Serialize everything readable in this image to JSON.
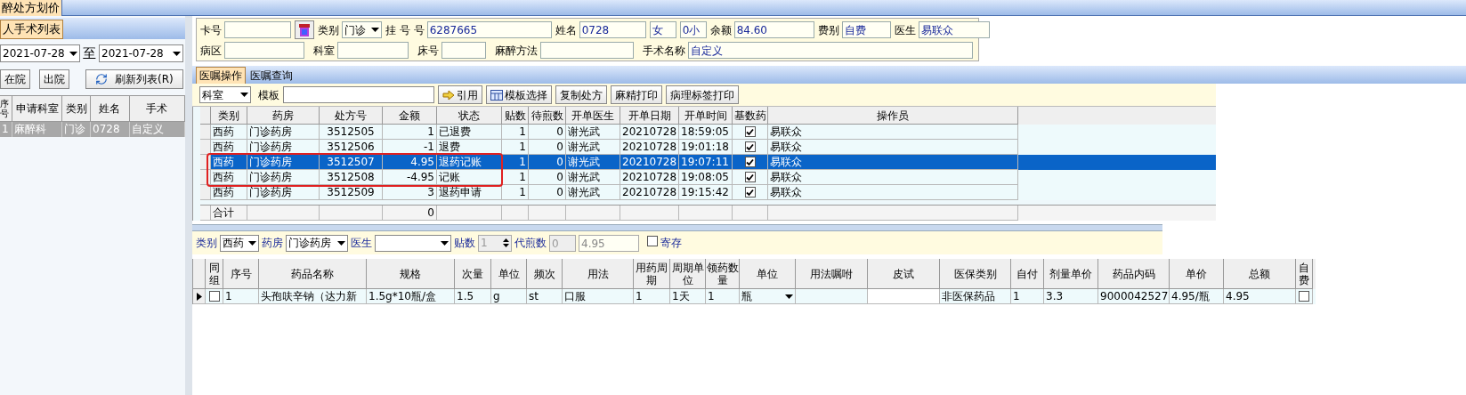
{
  "app_tab": "醉处方划价",
  "left": {
    "tab": "人手术列表",
    "date_from": "2021-07-28",
    "to_label": "至",
    "date_to": "2021-07-28",
    "buttons": [
      {
        "label": "在院",
        "kind": "plain"
      },
      {
        "label": "出院",
        "kind": "plain"
      },
      {
        "label": "刷新列表(R)",
        "kind": "refresh"
      }
    ],
    "columns": [
      "序号",
      "申请科室",
      "类别",
      "姓名",
      "手术"
    ],
    "rows": [
      {
        "cells": [
          "1",
          "麻醉科",
          "门诊",
          "0728",
          "自定义"
        ],
        "selected": true
      }
    ]
  },
  "form": {
    "line_1": [
      {
        "label": "卡号",
        "kind": "text"
      },
      {
        "kind": "reader"
      },
      {
        "label": "类别",
        "kind": "select",
        "value": "门诊"
      },
      {
        "label": "挂 号 号",
        "kind": "text",
        "value": "6287665"
      },
      {
        "label": "姓名",
        "kind": "text",
        "value": "0728"
      },
      {
        "kind": "text",
        "value": "女"
      },
      {
        "kind": "text",
        "value": "0小"
      },
      {
        "label": "余额",
        "kind": "text",
        "value": "84.60"
      },
      {
        "label": "费别",
        "kind": "text",
        "value": "自费"
      },
      {
        "label": "医生",
        "kind": "text",
        "value": "易联众"
      }
    ],
    "line_2": [
      {
        "label": "病区",
        "kind": "text"
      },
      {
        "label": "科室",
        "kind": "text"
      },
      {
        "label": "床号",
        "kind": "text"
      },
      {
        "label": "麻醉方法",
        "kind": "text"
      },
      {
        "label": "手术名称",
        "kind": "text",
        "value": "自定义"
      }
    ]
  },
  "tabs": [
    {
      "label": "医嘱操作",
      "selected": true
    },
    {
      "label": "医嘱查询",
      "selected": false
    }
  ],
  "toolbar": {
    "dept": "科室",
    "template_label": "模板",
    "buttons": [
      {
        "label": "引用",
        "kind": "quote"
      },
      {
        "label": "模板选择",
        "kind": "template"
      },
      {
        "label": "复制处方",
        "kind": "plain"
      },
      {
        "label": "麻精打印",
        "kind": "plain"
      },
      {
        "label": "病理标签打印",
        "kind": "plain"
      }
    ]
  },
  "orders": {
    "columns": [
      "类别",
      "药房",
      "处方号",
      "金额",
      "状态",
      "贴数",
      "待煎数",
      "开单医生",
      "开单日期",
      "开单时间",
      "基数药",
      "操作员"
    ],
    "rows": [
      {
        "cells": [
          "西药",
          "门诊药房",
          "3512505",
          "1",
          "已退费",
          "1",
          "0",
          "谢光武",
          "20210728",
          "18:59:05"
        ],
        "basic_drug": true,
        "operator": "易联众",
        "selected": false,
        "annotated": false
      },
      {
        "cells": [
          "西药",
          "门诊药房",
          "3512506",
          "-1",
          "退费",
          "1",
          "0",
          "谢光武",
          "20210728",
          "19:01:18"
        ],
        "basic_drug": true,
        "operator": "易联众",
        "selected": false,
        "annotated": false
      },
      {
        "cells": [
          "西药",
          "门诊药房",
          "3512507",
          "4.95",
          "退药记账",
          "1",
          "0",
          "谢光武",
          "20210728",
          "19:07:11"
        ],
        "basic_drug": true,
        "operator": "易联众",
        "selected": true,
        "annotated": true
      },
      {
        "cells": [
          "西药",
          "门诊药房",
          "3512508",
          "-4.95",
          "记账",
          "1",
          "0",
          "谢光武",
          "20210728",
          "19:08:05"
        ],
        "basic_drug": true,
        "operator": "易联众",
        "selected": false,
        "annotated": true
      },
      {
        "cells": [
          "西药",
          "门诊药房",
          "3512509",
          "3",
          "退药申请",
          "1",
          "0",
          "谢光武",
          "20210728",
          "19:15:42"
        ],
        "basic_drug": true,
        "operator": "易联众",
        "selected": false,
        "annotated": false
      }
    ],
    "total": {
      "label": "合计",
      "amount": "0"
    }
  },
  "filter": {
    "type_label": "类别",
    "type": "西药",
    "pharmacy_label": "药房",
    "pharmacy": "门诊药房",
    "doctor_label": "医生",
    "doses_label": "贴数",
    "doses": "1",
    "doses_disabled": true,
    "decoct_label": "代煎数",
    "decoct": "0",
    "decoct_disabled": true,
    "amount": "4.95",
    "deposit_label": "寄存",
    "deposit": false
  },
  "items": {
    "group_column": "同组",
    "self_pay_column": "自费",
    "columns": [
      "序号",
      "药品名称",
      "规格",
      "次量",
      "单位",
      "频次",
      "用法",
      "用药周期",
      "周期单位",
      "领药数量",
      "单位",
      "用法嘱咐",
      "皮试",
      "医保类别",
      "自付",
      "剂量单价",
      "药品内码",
      "单价",
      "总额"
    ],
    "rows": [
      {
        "group": false,
        "cells": [
          "1",
          "头孢呋辛钠（达力新",
          "1.5g*10瓶/盒",
          "1.5",
          "g",
          "st",
          "口服",
          "1",
          "1天",
          "1",
          "瓶",
          null,
          null,
          "非医保药品",
          "1",
          "3.3",
          "9000042527",
          "4.95/瓶",
          "4.95"
        ],
        "self_pay": false,
        "selected": true
      }
    ]
  }
}
